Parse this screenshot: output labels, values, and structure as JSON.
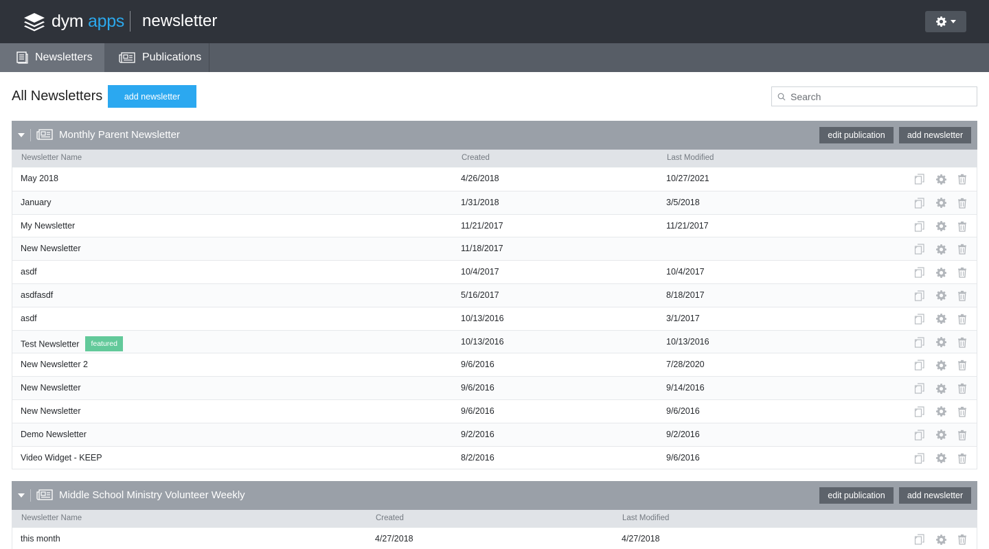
{
  "header": {
    "brand_main": "dym",
    "brand_accent": "apps",
    "app_name": "newsletter"
  },
  "tabs": [
    {
      "label": "Newsletters",
      "active": true,
      "icon": "newsletter-doc-icon"
    },
    {
      "label": "Publications",
      "active": false,
      "icon": "newspaper-icon"
    }
  ],
  "page": {
    "title": "All Newsletters",
    "add_button": "add newsletter",
    "search_placeholder": "Search"
  },
  "colors": {
    "topbar": "#2f333a",
    "tabbar": "#575d66",
    "accent_blue": "#2ba8f0",
    "featured_green": "#62c99a",
    "section_header": "#9aa0a8"
  },
  "publications": [
    {
      "title": "Monthly Parent Newsletter",
      "edit_label": "edit publication",
      "add_label": "add newsletter",
      "columns": {
        "name": "Newsletter Name",
        "created": "Created",
        "modified": "Last Modified"
      },
      "rows": [
        {
          "name": "May 2018",
          "created": "4/26/2018",
          "modified": "10/27/2021",
          "badge": ""
        },
        {
          "name": "January",
          "created": "1/31/2018",
          "modified": "3/5/2018",
          "badge": ""
        },
        {
          "name": "My Newsletter",
          "created": "11/21/2017",
          "modified": "11/21/2017",
          "badge": ""
        },
        {
          "name": "New Newsletter",
          "created": "11/18/2017",
          "modified": "",
          "badge": ""
        },
        {
          "name": "asdf",
          "created": "10/4/2017",
          "modified": "10/4/2017",
          "badge": ""
        },
        {
          "name": "asdfasdf",
          "created": "5/16/2017",
          "modified": "8/18/2017",
          "badge": ""
        },
        {
          "name": "asdf",
          "created": "10/13/2016",
          "modified": "3/1/2017",
          "badge": ""
        },
        {
          "name": "Test Newsletter",
          "created": "10/13/2016",
          "modified": "10/13/2016",
          "badge": "featured"
        },
        {
          "name": "New Newsletter 2",
          "created": "9/6/2016",
          "modified": "7/28/2020",
          "badge": ""
        },
        {
          "name": "New Newsletter",
          "created": "9/6/2016",
          "modified": "9/14/2016",
          "badge": ""
        },
        {
          "name": "New Newsletter",
          "created": "9/6/2016",
          "modified": "9/6/2016",
          "badge": ""
        },
        {
          "name": "Demo Newsletter",
          "created": "9/2/2016",
          "modified": "9/2/2016",
          "badge": ""
        },
        {
          "name": "Video Widget - KEEP",
          "created": "8/2/2016",
          "modified": "9/6/2016",
          "badge": ""
        }
      ]
    },
    {
      "title": "Middle School Ministry Volunteer Weekly",
      "edit_label": "edit publication",
      "add_label": "add newsletter",
      "columns": {
        "name": "Newsletter Name",
        "created": "Created",
        "modified": "Last Modified"
      },
      "rows": [
        {
          "name": "this month",
          "created": "4/27/2018",
          "modified": "4/27/2018",
          "badge": ""
        }
      ]
    }
  ]
}
